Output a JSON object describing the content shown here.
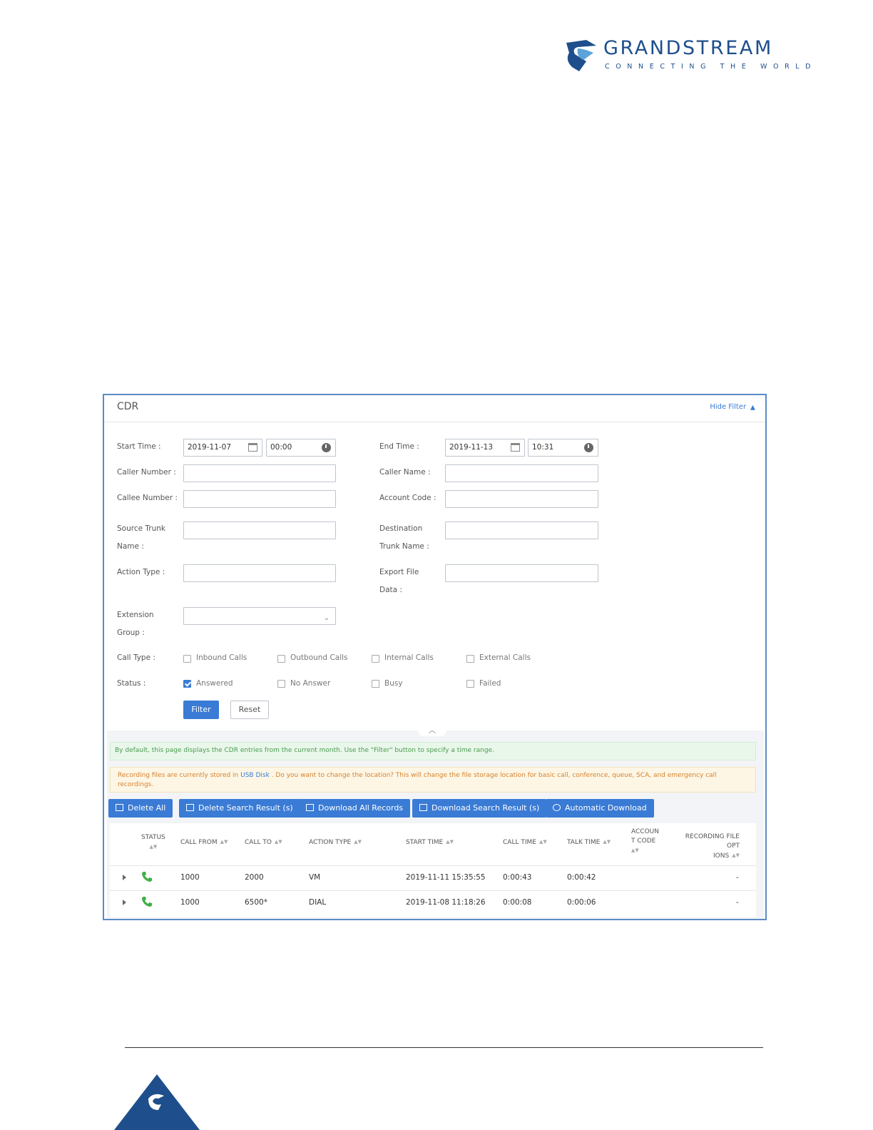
{
  "header": {
    "logo_name": "GRANDSTREAM",
    "logo_tagline": "CONNECTING THE WORLD",
    "brand_color": "#1e4f8c"
  },
  "panel": {
    "title": "CDR",
    "hide_filter": "Hide Filter"
  },
  "filters": {
    "start_time_label": "Start Time :",
    "start_date": "2019-11-07",
    "start_clock": "00:00",
    "end_time_label": "End Time :",
    "end_date": "2019-11-13",
    "end_clock": "10:31",
    "caller_number_label": "Caller Number :",
    "caller_name_label": "Caller Name :",
    "callee_number_label": "Callee Number :",
    "account_code_label": "Account Code :",
    "source_trunk_label_1": "Source Trunk",
    "source_trunk_label_2": "Name :",
    "destination_trunk_label_1": "Destination",
    "destination_trunk_label_2": "Trunk Name :",
    "action_type_label": "Action Type :",
    "export_file_label_1": "Export File",
    "export_file_label_2": "Data :",
    "extension_group_label_1": "Extension",
    "extension_group_label_2": "Group :",
    "call_type_label": "Call Type :",
    "call_types": [
      {
        "label": "Inbound Calls",
        "checked": false
      },
      {
        "label": "Outbound Calls",
        "checked": false
      },
      {
        "label": "Internal Calls",
        "checked": false
      },
      {
        "label": "External Calls",
        "checked": false
      }
    ],
    "status_label": "Status :",
    "statuses": [
      {
        "label": "Answered",
        "checked": true
      },
      {
        "label": "No Answer",
        "checked": false
      },
      {
        "label": "Busy",
        "checked": false
      },
      {
        "label": "Failed",
        "checked": false
      }
    ],
    "filter_button": "Filter",
    "reset_button": "Reset"
  },
  "notices": {
    "info": "By default, this page displays the CDR entries from the current month. Use the \"Filter\" button to specify a time range.",
    "warning_prefix": "Recording files are currently stored in",
    "warning_link": "USB Disk",
    "warning_suffix": ". Do you want to change the location? This will change the file storage location for basic call, conference, queue, SCA, and emergency call recordings."
  },
  "actions": {
    "delete_all": "Delete All",
    "delete_search": "Delete Search Result (s)",
    "download_all": "Download All Records",
    "download_search": "Download Search Result (s)",
    "auto_download": "Automatic Download"
  },
  "table": {
    "columns": {
      "status": "STATUS",
      "call_from": "CALL FROM",
      "call_to": "CALL TO",
      "action_type": "ACTION TYPE",
      "start_time": "START TIME",
      "call_time": "CALL TIME",
      "talk_time": "TALK TIME",
      "account_code_1": "ACCOUN",
      "account_code_2": "T CODE",
      "recording_1": "RECORDING FILE OPT",
      "recording_2": "IONS"
    },
    "rows": [
      {
        "call_from": "1000",
        "call_to": "2000",
        "action_type": "VM",
        "start_time": "2019-11-11 15:35:55",
        "call_time": "0:00:43",
        "talk_time": "0:00:42",
        "recording": "-"
      },
      {
        "call_from": "1000",
        "call_to": "6500*",
        "action_type": "DIAL",
        "start_time": "2019-11-08 11:18:26",
        "call_time": "0:00:08",
        "talk_time": "0:00:06",
        "recording": "-"
      }
    ]
  },
  "colors": {
    "primary": "#3a7bd5",
    "frame_border": "#5b8cc4",
    "answered_icon": "#3cb043"
  }
}
